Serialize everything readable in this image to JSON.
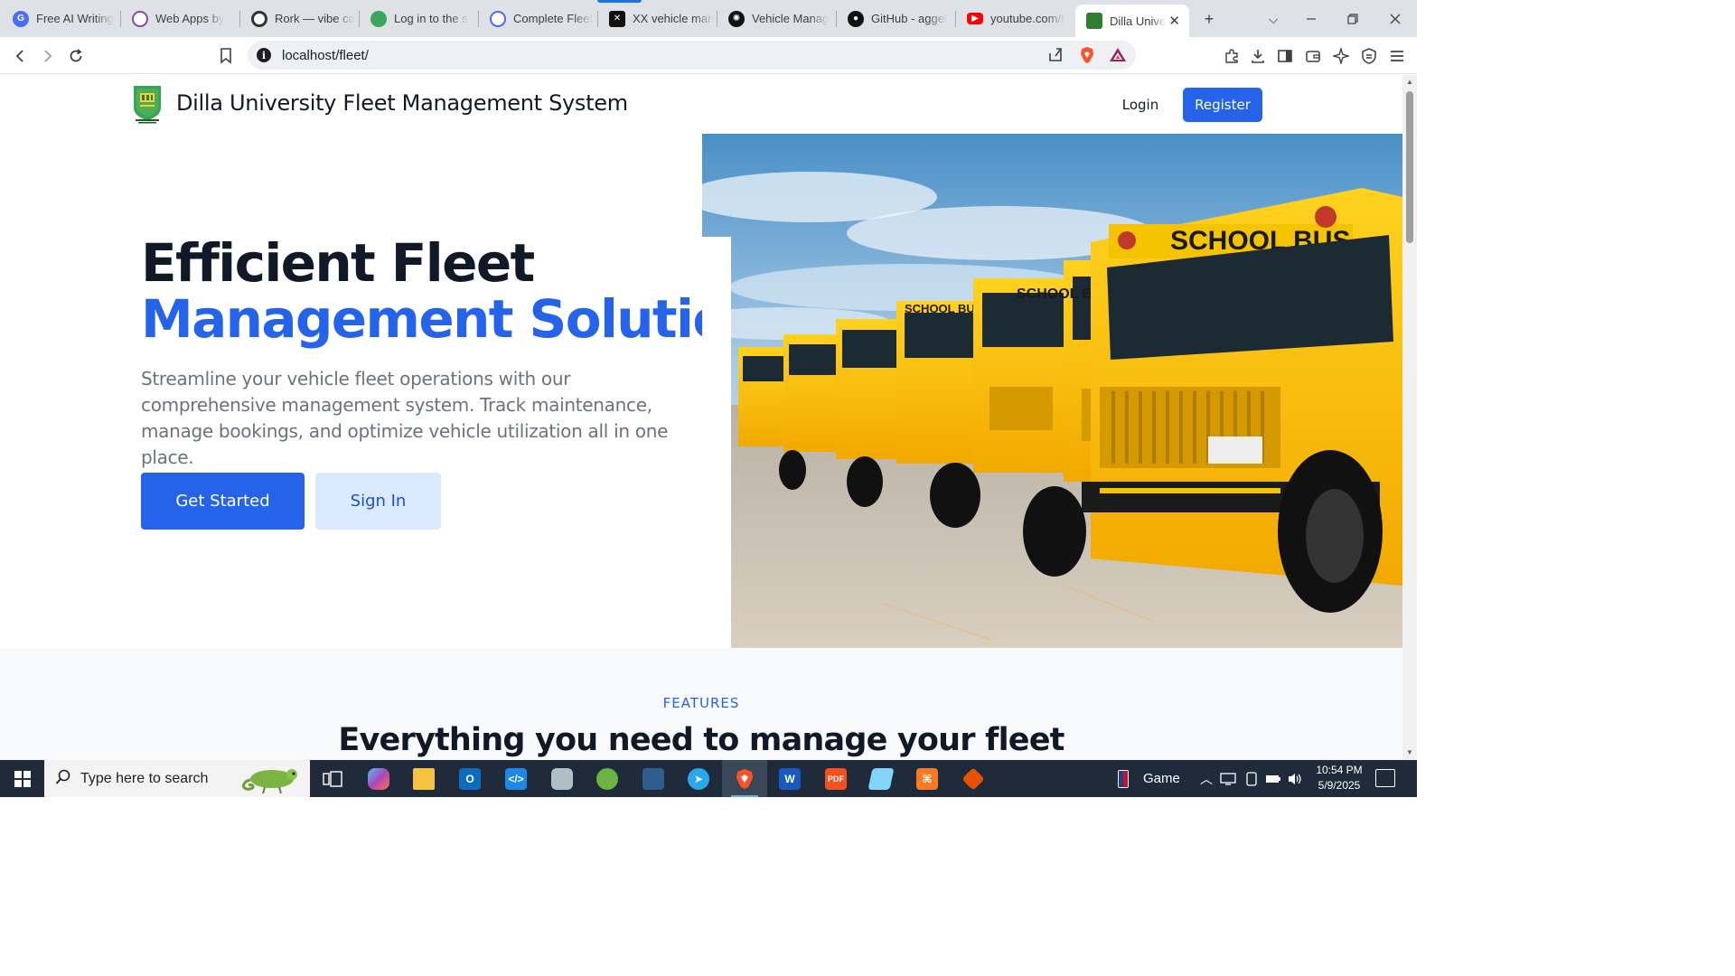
{
  "browser": {
    "tabs": [
      {
        "title": "Free AI Writing",
        "favicon_color": "#4a6cf7",
        "favicon_name": "ai-writing-icon"
      },
      {
        "title": "Web Apps by",
        "favicon_color": "#8e44ad",
        "favicon_name": "web-apps-icon"
      },
      {
        "title": "Rork — vibe co",
        "favicon_color": "#333333",
        "favicon_name": "rork-icon"
      },
      {
        "title": "Log in to the s",
        "favicon_color": "#3ba55c",
        "favicon_name": "login-site-icon"
      },
      {
        "title": "Complete Fleet",
        "favicon_color": "#4a6cf7",
        "favicon_name": "fleet-ai-icon"
      },
      {
        "title": "XX vehicle man",
        "favicon_color": "#111111",
        "favicon_name": "xx-icon"
      },
      {
        "title": "Vehicle Manag",
        "favicon_color": "#111111",
        "favicon_name": "openai-icon"
      },
      {
        "title": "GitHub - aggel",
        "favicon_color": "#111111",
        "favicon_name": "github-icon"
      },
      {
        "title": "youtube.com/f",
        "favicon_color": "#ff0000",
        "favicon_name": "youtube-icon"
      },
      {
        "title": "Dilla Unive",
        "favicon_color": "#2e7d32",
        "favicon_name": "dilla-university-icon",
        "active": true
      }
    ],
    "new_tab_symbol": "+",
    "url": "localhost/fleet/"
  },
  "site": {
    "brand": "Dilla University Fleet Management System",
    "nav": {
      "login": "Login",
      "register": "Register"
    },
    "hero": {
      "title_line1": "Efficient Fleet",
      "title_line2": "Management Solution",
      "description": "Streamline your vehicle fleet operations with our comprehensive management system. Track maintenance, manage bookings, and optimize vehicle utilization all in one place.",
      "primary_cta": "Get Started",
      "secondary_cta": "Sign In",
      "image_alt": "Row of yellow school buses",
      "bus_sign": "SCHOOL BUS"
    },
    "features": {
      "tag": "FEATURES",
      "title": "Everything you need to manage your fleet"
    },
    "colors": {
      "primary": "#2563eb",
      "primary_light": "#dbeafe",
      "heading": "#111827",
      "muted": "#6b7280"
    }
  },
  "taskbar": {
    "search_placeholder": "Type here to search",
    "tray_label": "Game",
    "time": "10:54 PM",
    "date": "5/9/2025"
  }
}
